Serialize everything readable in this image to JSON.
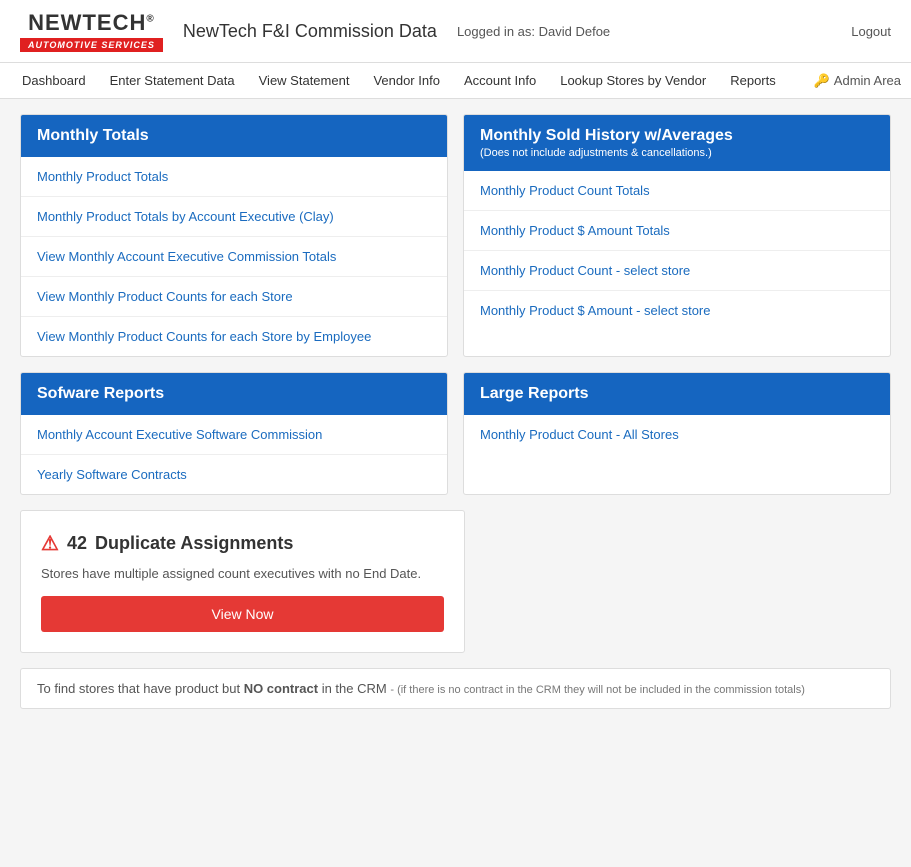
{
  "header": {
    "logo_name": "NEWTECH",
    "logo_sup": "®",
    "logo_subtitle": "AUTOMOTIVE SERVICES",
    "title": "NewTech F&I Commission Data",
    "logged_in_label": "Logged in as: David Defoe",
    "logout_label": "Logout"
  },
  "navbar": {
    "items": [
      {
        "label": "Dashboard"
      },
      {
        "label": "Enter Statement Data"
      },
      {
        "label": "View Statement"
      },
      {
        "label": "Vendor Info"
      },
      {
        "label": "Account Info"
      },
      {
        "label": "Lookup Stores by Vendor"
      },
      {
        "label": "Reports"
      }
    ],
    "admin_label": "Admin Area"
  },
  "monthly_totals": {
    "header": "Monthly Totals",
    "items": [
      "Monthly Product Totals",
      "Monthly Product Totals by Account Executive (Clay)",
      "View Monthly Account Executive Commission Totals",
      "View Monthly Product Counts for each Store",
      "View Monthly Product Counts for each Store by Employee"
    ]
  },
  "monthly_sold_history": {
    "header": "Monthly Sold History w/Averages",
    "header_subtitle": "(Does not include adjustments & cancellations.)",
    "items": [
      "Monthly Product Count Totals",
      "Monthly Product $ Amount Totals",
      "Monthly Product Count - select store",
      "Monthly Product $ Amount - select store"
    ]
  },
  "software_reports": {
    "header": "Sofware Reports",
    "items": [
      "Monthly Account Executive Software Commission",
      "Yearly Software Contracts"
    ]
  },
  "large_reports": {
    "header": "Large Reports",
    "items": [
      "Monthly Product Count - All Stores"
    ]
  },
  "alert": {
    "count": "42",
    "title": "Duplicate Assignments",
    "description": "Stores have multiple assigned count executives with no End Date.",
    "button_label": "View Now"
  },
  "info_bar": {
    "prefix": "To find stores that have product but ",
    "bold_text": "NO contract",
    "middle": " in the CRM ",
    "small_text": "- (if there is no contract in the CRM they will not be included in the commission totals)"
  }
}
